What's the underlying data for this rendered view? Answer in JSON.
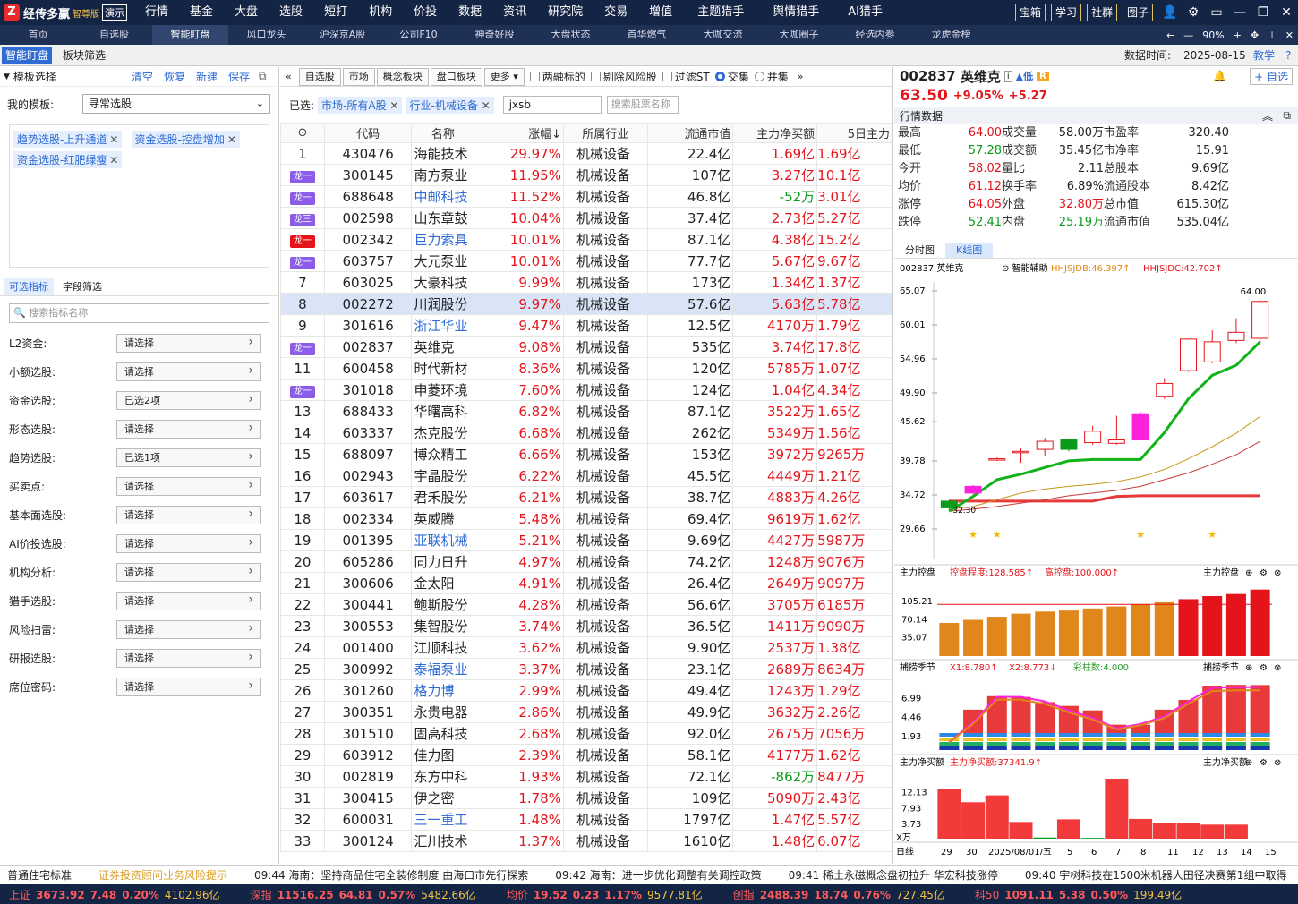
{
  "app": {
    "logo_text": "经传多赢",
    "edition": "智尊版",
    "demo": "演示"
  },
  "main_menu": [
    "行情",
    "基金",
    "大盘",
    "选股",
    "短打",
    "机构",
    "价投",
    "数据",
    "资讯",
    "研究院",
    "交易",
    "增值",
    "主题猎手",
    "舆情猎手",
    "AI猎手"
  ],
  "top_buttons": [
    "宝箱",
    "学习",
    "社群",
    "圈子"
  ],
  "tabs": [
    "首页",
    "自选股",
    "智能盯盘",
    "风口龙头",
    "沪深京A股",
    "公司F10",
    "神奇好股",
    "大盘状态",
    "首华燃气",
    "大咖交流",
    "大咖圈子",
    "经选内参",
    "龙虎金榜"
  ],
  "zoom": "90%",
  "subtabs": [
    "智能盯盘",
    "板块筛选"
  ],
  "data_time_label": "数据时间:",
  "data_time": "2025-08-15",
  "teach": "教学",
  "left": {
    "title": "模板选择",
    "actions": [
      "清空",
      "恢复",
      "新建",
      "保存"
    ],
    "template_label": "我的模板:",
    "template_value": "寻常选股",
    "chips": [
      "趋势选股-上升通道",
      "资金选股-控盘增加",
      "资金选股-红肥绿瘦"
    ],
    "tabs": [
      "可选指标",
      "字段筛选"
    ],
    "search_placeholder": "搜索指标名称",
    "filters": [
      {
        "label": "L2资金:",
        "value": "请选择"
      },
      {
        "label": "小额选股:",
        "value": "请选择"
      },
      {
        "label": "资金选股:",
        "value": "已选2项"
      },
      {
        "label": "形态选股:",
        "value": "请选择"
      },
      {
        "label": "趋势选股:",
        "value": "已选1项"
      },
      {
        "label": "买卖点:",
        "value": "请选择"
      },
      {
        "label": "基本面选股:",
        "value": "请选择"
      },
      {
        "label": "AI价投选股:",
        "value": "请选择"
      },
      {
        "label": "机构分析:",
        "value": "请选择"
      },
      {
        "label": "猎手选股:",
        "value": "请选择"
      },
      {
        "label": "风险扫雷:",
        "value": "请选择"
      },
      {
        "label": "研报选股:",
        "value": "请选择"
      },
      {
        "label": "席位密码:",
        "value": "请选择"
      }
    ]
  },
  "mid": {
    "tools": [
      "自选股",
      "市场",
      "概念板块",
      "盘口板块",
      "更多"
    ],
    "checks": [
      "两融标的",
      "剔除风险股",
      "过滤ST"
    ],
    "radios": [
      "交集",
      "并集"
    ],
    "selected_label": "已选:",
    "selected": [
      "市场-所有A股",
      "行业-机械设备"
    ],
    "search_value": "jxsb",
    "search_placeholder": "搜索股票名称",
    "headers": [
      "代码",
      "名称",
      "涨幅↓",
      "所属行业",
      "流通市值",
      "主力净买额",
      "5日主力"
    ],
    "rows": [
      [
        "1",
        "",
        "430476",
        "海能技术",
        "29.97%",
        "机械设备",
        "22.4亿",
        "1.69亿",
        "1.69亿",
        false
      ],
      [
        "",
        "龙一",
        "300145",
        "南方泵业",
        "11.95%",
        "机械设备",
        "107亿",
        "3.27亿",
        "10.1亿",
        false
      ],
      [
        "",
        "龙一",
        "688648",
        "中邮科技",
        "11.52%",
        "机械设备",
        "46.8亿",
        "-52万",
        "3.01亿",
        true
      ],
      [
        "",
        "龙三",
        "002598",
        "山东章鼓",
        "10.04%",
        "机械设备",
        "37.4亿",
        "2.73亿",
        "5.27亿",
        false
      ],
      [
        "",
        "龙一",
        "002342",
        "巨力索具",
        "10.01%",
        "机械设备",
        "87.1亿",
        "4.38亿",
        "15.2亿",
        true
      ],
      [
        "",
        "龙一",
        "603757",
        "大元泵业",
        "10.01%",
        "机械设备",
        "77.7亿",
        "5.67亿",
        "9.67亿",
        false
      ],
      [
        "7",
        "",
        "603025",
        "大豪科技",
        "9.99%",
        "机械设备",
        "173亿",
        "1.34亿",
        "1.37亿",
        false
      ],
      [
        "8",
        "",
        "002272",
        "川润股份",
        "9.97%",
        "机械设备",
        "57.6亿",
        "5.63亿",
        "5.78亿",
        false
      ],
      [
        "9",
        "",
        "301616",
        "浙江华业",
        "9.47%",
        "机械设备",
        "12.5亿",
        "4170万",
        "1.79亿",
        true
      ],
      [
        "",
        "龙一",
        "002837",
        "英维克",
        "9.08%",
        "机械设备",
        "535亿",
        "3.74亿",
        "17.8亿",
        false
      ],
      [
        "11",
        "",
        "600458",
        "时代新材",
        "8.36%",
        "机械设备",
        "120亿",
        "5785万",
        "1.07亿",
        false
      ],
      [
        "",
        "龙一",
        "301018",
        "申菱环境",
        "7.60%",
        "机械设备",
        "124亿",
        "1.04亿",
        "4.34亿",
        false
      ],
      [
        "13",
        "",
        "688433",
        "华曙高科",
        "6.82%",
        "机械设备",
        "87.1亿",
        "3522万",
        "1.65亿",
        false
      ],
      [
        "14",
        "",
        "603337",
        "杰克股份",
        "6.68%",
        "机械设备",
        "262亿",
        "5349万",
        "1.56亿",
        false
      ],
      [
        "15",
        "",
        "688097",
        "博众精工",
        "6.66%",
        "机械设备",
        "153亿",
        "3972万",
        "9265万",
        false
      ],
      [
        "16",
        "",
        "002943",
        "宇晶股份",
        "6.22%",
        "机械设备",
        "45.5亿",
        "4449万",
        "1.21亿",
        false
      ],
      [
        "17",
        "",
        "603617",
        "君禾股份",
        "6.21%",
        "机械设备",
        "38.7亿",
        "4883万",
        "4.26亿",
        false
      ],
      [
        "18",
        "",
        "002334",
        "英威腾",
        "5.48%",
        "机械设备",
        "69.4亿",
        "9619万",
        "1.62亿",
        false
      ],
      [
        "19",
        "",
        "001395",
        "亚联机械",
        "5.21%",
        "机械设备",
        "9.69亿",
        "4427万",
        "5987万",
        true
      ],
      [
        "20",
        "",
        "605286",
        "同力日升",
        "4.97%",
        "机械设备",
        "74.2亿",
        "1248万",
        "9076万",
        false
      ],
      [
        "21",
        "",
        "300606",
        "金太阳",
        "4.91%",
        "机械设备",
        "26.4亿",
        "2649万",
        "9097万",
        false
      ],
      [
        "22",
        "",
        "300441",
        "鲍斯股份",
        "4.28%",
        "机械设备",
        "56.6亿",
        "3705万",
        "6185万",
        false
      ],
      [
        "23",
        "",
        "300553",
        "集智股份",
        "3.74%",
        "机械设备",
        "36.5亿",
        "1411万",
        "9090万",
        false
      ],
      [
        "24",
        "",
        "001400",
        "江顺科技",
        "3.62%",
        "机械设备",
        "9.90亿",
        "2537万",
        "1.38亿",
        false
      ],
      [
        "25",
        "",
        "300992",
        "泰福泵业",
        "3.37%",
        "机械设备",
        "23.1亿",
        "2689万",
        "8634万",
        true
      ],
      [
        "26",
        "",
        "301260",
        "格力博",
        "2.99%",
        "机械设备",
        "49.4亿",
        "1243万",
        "1.29亿",
        true
      ],
      [
        "27",
        "",
        "300351",
        "永贵电器",
        "2.86%",
        "机械设备",
        "49.9亿",
        "3632万",
        "2.26亿",
        false
      ],
      [
        "28",
        "",
        "301510",
        "固高科技",
        "2.68%",
        "机械设备",
        "92.0亿",
        "2675万",
        "7056万",
        false
      ],
      [
        "29",
        "",
        "603912",
        "佳力图",
        "2.39%",
        "机械设备",
        "58.1亿",
        "4177万",
        "1.62亿",
        false
      ],
      [
        "30",
        "",
        "002819",
        "东方中科",
        "1.93%",
        "机械设备",
        "72.1亿",
        "-862万",
        "8477万",
        false
      ],
      [
        "31",
        "",
        "300415",
        "伊之密",
        "1.78%",
        "机械设备",
        "109亿",
        "5090万",
        "2.43亿",
        false
      ],
      [
        "32",
        "",
        "600031",
        "三一重工",
        "1.48%",
        "机械设备",
        "1797亿",
        "1.47亿",
        "5.57亿",
        true
      ],
      [
        "33",
        "",
        "300124",
        "汇川技术",
        "1.37%",
        "机械设备",
        "1610亿",
        "1.48亿",
        "6.07亿",
        false
      ]
    ]
  },
  "right": {
    "code": "002837",
    "name": "英维克",
    "risk": "低",
    "tag": "R",
    "price": "63.50",
    "pct": "+9.05%",
    "chg": "+5.27",
    "add_label": "+ 自选",
    "quote_title": "行情数据",
    "quote": [
      [
        "最高",
        "64.00",
        "成交量",
        "58.00万",
        "市盈率",
        "320.40"
      ],
      [
        "最低",
        "57.28",
        "成交额",
        "35.45亿",
        "市净率",
        "15.91"
      ],
      [
        "今开",
        "58.02",
        "量比",
        "2.11",
        "总股本",
        "9.69亿"
      ],
      [
        "均价",
        "61.12",
        "换手率",
        "6.89%",
        "流通股本",
        "8.42亿"
      ],
      [
        "涨停",
        "64.05",
        "外盘",
        "32.80万",
        "总市值",
        "615.30亿"
      ],
      [
        "跌停",
        "52.41",
        "内盘",
        "25.19万",
        "流通市值",
        "535.04亿"
      ]
    ],
    "chart_tabs": [
      "分时图",
      "K线图"
    ],
    "kline_head": {
      "name": "002837 英维克",
      "assist": "智能辅助",
      "a": "HHJSJDB:46.397",
      "b": "HHJSJDC:42.702"
    },
    "kline_yticks": [
      "65.07",
      "60.01",
      "54.96",
      "49.90",
      "45.62",
      "39.78",
      "34.72",
      "29.66"
    ],
    "kline_high": "64.00",
    "kline_low": "32.30",
    "p1": {
      "title": "主力控盘",
      "a": "控盘程度:128.585",
      "b": "高控盘:100.000",
      "right": "主力控盘",
      "ticks": [
        "105.21",
        "70.14",
        "35.07"
      ]
    },
    "p2": {
      "title": "捕捞季节",
      "a": "X1:8.780",
      "b": "X2:8.773",
      "c": "彩柱数:4.000",
      "right": "捕捞季节",
      "ticks": [
        "6.99",
        "4.46",
        "1.93"
      ]
    },
    "p3": {
      "title": "主力净买额",
      "a": "主力净买额:37341.9",
      "right": "主力净买额",
      "ticks": [
        "12.13",
        "7.93",
        "3.73"
      ],
      "unit": "X万"
    },
    "xaxis": [
      "日线",
      "29",
      "30",
      "2025/08/01/五",
      "5",
      "6",
      "7",
      "8",
      "11",
      "12",
      "13",
      "14",
      "15"
    ]
  },
  "chart_data": {
    "type": "candlestick",
    "candles": [
      [
        33.8,
        32.8,
        34.0,
        32.3
      ],
      [
        35.0,
        36.0,
        36.2,
        34.8
      ],
      [
        39.9,
        40.1,
        40.3,
        39.8
      ],
      [
        41.0,
        41.2,
        41.6,
        39.5
      ],
      [
        41.5,
        42.7,
        43.2,
        40.5
      ],
      [
        42.9,
        41.5,
        43.1,
        41.2
      ],
      [
        42.5,
        44.2,
        45.0,
        42.2
      ],
      [
        42.4,
        42.9,
        46.5,
        42.2
      ],
      [
        42.9,
        46.8,
        47.1,
        42.9
      ],
      [
        49.4,
        51.3,
        52.1,
        49.0
      ],
      [
        53.2,
        57.9,
        58.0,
        53.0
      ],
      [
        54.5,
        57.5,
        59.2,
        54.3
      ],
      [
        57.7,
        58.9,
        61.0,
        57.3
      ],
      [
        58.02,
        63.5,
        64.0,
        57.28
      ]
    ],
    "line_green": [
      32.3,
      34.5,
      37.0,
      37.8,
      38.8,
      39.8,
      40.0,
      40.0,
      40.0,
      44.0,
      49.0,
      52.5,
      54.0,
      57.5
    ],
    "line_yellow": [
      32.6,
      33.0,
      34.0,
      35.0,
      35.6,
      36.0,
      36.3,
      36.7,
      37.4,
      38.5,
      40.1,
      41.9,
      43.9,
      46.4
    ],
    "line_red1": [
      32.3,
      32.6,
      33.0,
      33.5,
      34.0,
      34.6,
      35.0,
      35.4,
      36.0,
      37.0,
      38.0,
      39.3,
      40.7,
      42.7
    ],
    "line_red2": [
      33.8,
      33.8,
      33.8,
      33.8,
      33.8,
      33.8,
      33.8,
      34.5,
      34.6,
      34.6,
      34.6,
      34.6,
      34.6,
      34.6
    ],
    "control": [
      64,
      70,
      76,
      82,
      86,
      88,
      92,
      96,
      100,
      104,
      110,
      116,
      120,
      128.6
    ],
    "catch_bars": [
      1.5,
      5.5,
      7.3,
      7.2,
      6.5,
      6.0,
      5.4,
      3.5,
      3.5,
      5.5,
      6.8,
      8.7,
      8.8,
      8.78
    ],
    "catch_line": [
      1.2,
      3.8,
      7.2,
      7.2,
      6.6,
      5.4,
      4.4,
      3.0,
      3.6,
      4.6,
      6.6,
      8.4,
      8.5,
      8.5
    ],
    "netbuy": [
      13.0,
      9.6,
      11.4,
      4.4,
      0.3,
      5.1,
      0.2,
      15.8,
      5.2,
      4.2,
      4.1,
      3.7,
      3.7,
      0
    ],
    "ylim": [
      29.66,
      65.07
    ]
  },
  "ticker": {
    "items": [
      "普通住宅标准",
      "证券投资顾问业务风险提示",
      "09:44 海南：坚持商品住宅全装修制度 由海口市先行探索",
      "09:42 海南：进一步优化调整有关调控政策",
      "09:41 稀土永磁概念盘初拉升 华宏科技涨停",
      "09:40 宇树科技在1500米机器人田径决赛第1组中取得"
    ]
  },
  "indices": [
    {
      "name": "上证",
      "v": "3673.92",
      "c": "7.48",
      "p": "0.20%",
      "a": "4102.96亿"
    },
    {
      "name": "深指",
      "v": "11516.25",
      "c": "64.81",
      "p": "0.57%",
      "a": "5482.66亿"
    },
    {
      "name": "均价",
      "v": "19.52",
      "c": "0.23",
      "p": "1.17%",
      "a": "9577.81亿"
    },
    {
      "name": "创指",
      "v": "2488.39",
      "c": "18.74",
      "p": "0.76%",
      "a": "727.45亿"
    },
    {
      "name": "科50",
      "v": "1091.11",
      "c": "5.38",
      "p": "0.50%",
      "a": "199.49亿"
    }
  ],
  "colors": {
    "up": "#e4141a",
    "down": "#0a9a1c",
    "accent": "#2e6bd4",
    "nav": "#142444"
  }
}
